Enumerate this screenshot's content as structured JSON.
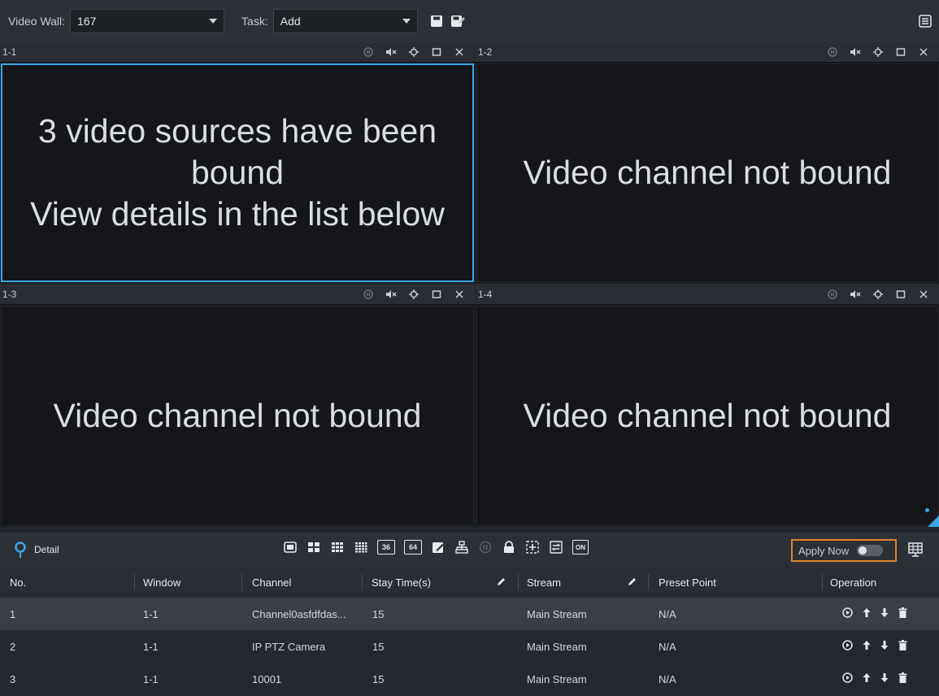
{
  "toolbar": {
    "video_wall_label": "Video Wall:",
    "video_wall_value": "167",
    "task_label": "Task:",
    "task_value": "Add"
  },
  "panes": [
    {
      "id": "1-1",
      "message": [
        "3 video sources have been",
        "bound",
        "View details in the list below"
      ]
    },
    {
      "id": "1-2",
      "message": [
        "Video channel not bound"
      ]
    },
    {
      "id": "1-3",
      "message": [
        "Video channel not bound"
      ]
    },
    {
      "id": "1-4",
      "message": [
        "Video channel not bound"
      ]
    }
  ],
  "detail": {
    "label": "Detail",
    "apply_now": "Apply Now",
    "tool_36": "36",
    "tool_64": "64",
    "tool_on": "ON"
  },
  "table": {
    "headers": {
      "no": "No.",
      "window": "Window",
      "channel": "Channel",
      "stay": "Stay Time(s)",
      "stream": "Stream",
      "preset": "Preset Point",
      "operation": "Operation"
    },
    "rows": [
      {
        "no": "1",
        "window": "1-1",
        "channel": "Channel0asfdfdas...",
        "stay": "15",
        "stream": "Main Stream",
        "preset": "N/A"
      },
      {
        "no": "2",
        "window": "1-1",
        "channel": "IP PTZ Camera",
        "stay": "15",
        "stream": "Main Stream",
        "preset": "N/A"
      },
      {
        "no": "3",
        "window": "1-1",
        "channel": "10001",
        "stay": "15",
        "stream": "Main Stream",
        "preset": "N/A"
      }
    ]
  },
  "colors": {
    "accent_blue": "#3ba7e6",
    "apply_border": "#e0822d"
  }
}
